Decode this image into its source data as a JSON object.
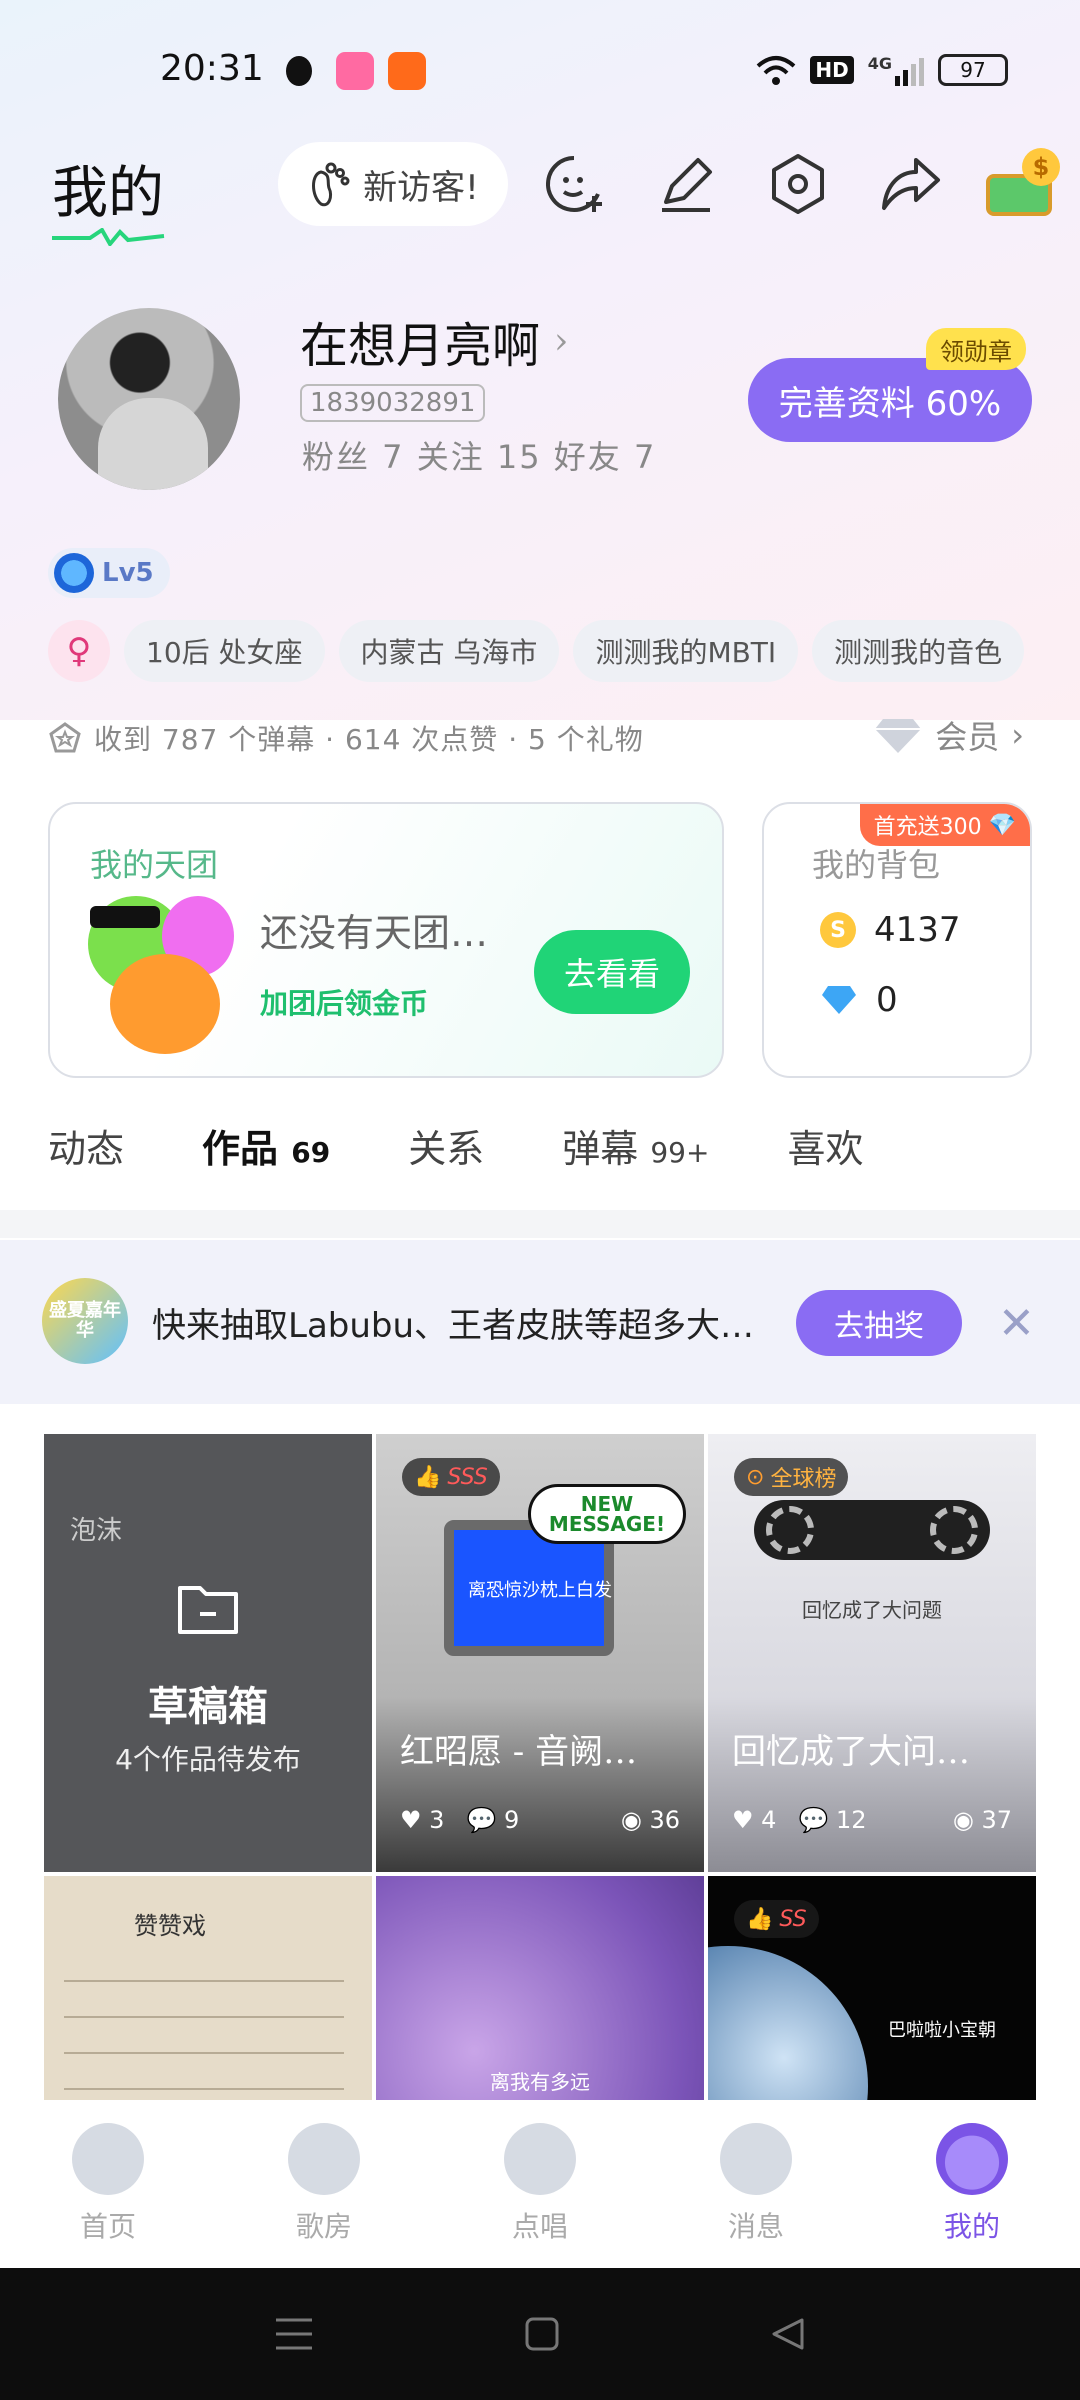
{
  "status_bar": {
    "time": "20:31",
    "network": "4G",
    "hd": "HD",
    "battery": "97"
  },
  "header": {
    "title": "我的",
    "visitor_label": "新访客!"
  },
  "profile": {
    "name": "在想月亮啊",
    "uid": "1839032891",
    "stats": "粉丝 7  关注 15  好友 7",
    "complete_button": "完善资料 60%",
    "medal_badge": "领勋章",
    "level": "Lv5"
  },
  "tags": [
    "10后 处女座",
    "内蒙古 乌海市",
    "测测我的MBTI",
    "测测我的音色"
  ],
  "gender_symbol": "♀",
  "receive_text": "收到 787 个弹幕 · 614 次点赞 · 5 个礼物",
  "member_label": "会员",
  "team_card": {
    "label": "我的天团",
    "empty_text": "还没有天团…",
    "sub_text": "加团后领金币",
    "go_button": "去看看"
  },
  "bag_card": {
    "label": "我的背包",
    "ribbon": "首充送300",
    "coins": "4137",
    "diamonds": "0"
  },
  "tabs": [
    {
      "label": "动态",
      "count": ""
    },
    {
      "label": "作品",
      "count": "69"
    },
    {
      "label": "关系",
      "count": ""
    },
    {
      "label": "弹幕",
      "count": "99+"
    },
    {
      "label": "喜欢",
      "count": ""
    }
  ],
  "banner": {
    "logo_text": "盛夏嘉年华",
    "text": "快来抽取Labubu、王者皮肤等超多大…",
    "button": "去抽奖"
  },
  "works": [
    {
      "type": "draft",
      "title": "草稿箱",
      "subtitle": "4个作品待发布",
      "preview_title": "泡沫"
    },
    {
      "caption": "红昭愿 - 音阙…",
      "badge": "SSS",
      "likes": "3",
      "comments": "9",
      "views": "36",
      "screen_text": "离恐惊沙枕上白发",
      "bubble": "NEW MESSAGE!"
    },
    {
      "caption": "回忆成了大问…",
      "badge": "全球榜",
      "likes": "4",
      "comments": "12",
      "views": "37",
      "screen_text": "回忆成了大问题"
    },
    {
      "caption": "",
      "screen_text": "赞赞戏"
    },
    {
      "caption": "",
      "screen_text": "离我有多远"
    },
    {
      "caption": "",
      "badge": "SS",
      "screen_text": "巴啦啦小宝朝"
    }
  ],
  "bottom_nav": [
    {
      "label": "首页",
      "active": false
    },
    {
      "label": "歌房",
      "active": false
    },
    {
      "label": "点唱",
      "active": false
    },
    {
      "label": "消息",
      "active": false
    },
    {
      "label": "我的",
      "active": true
    }
  ]
}
